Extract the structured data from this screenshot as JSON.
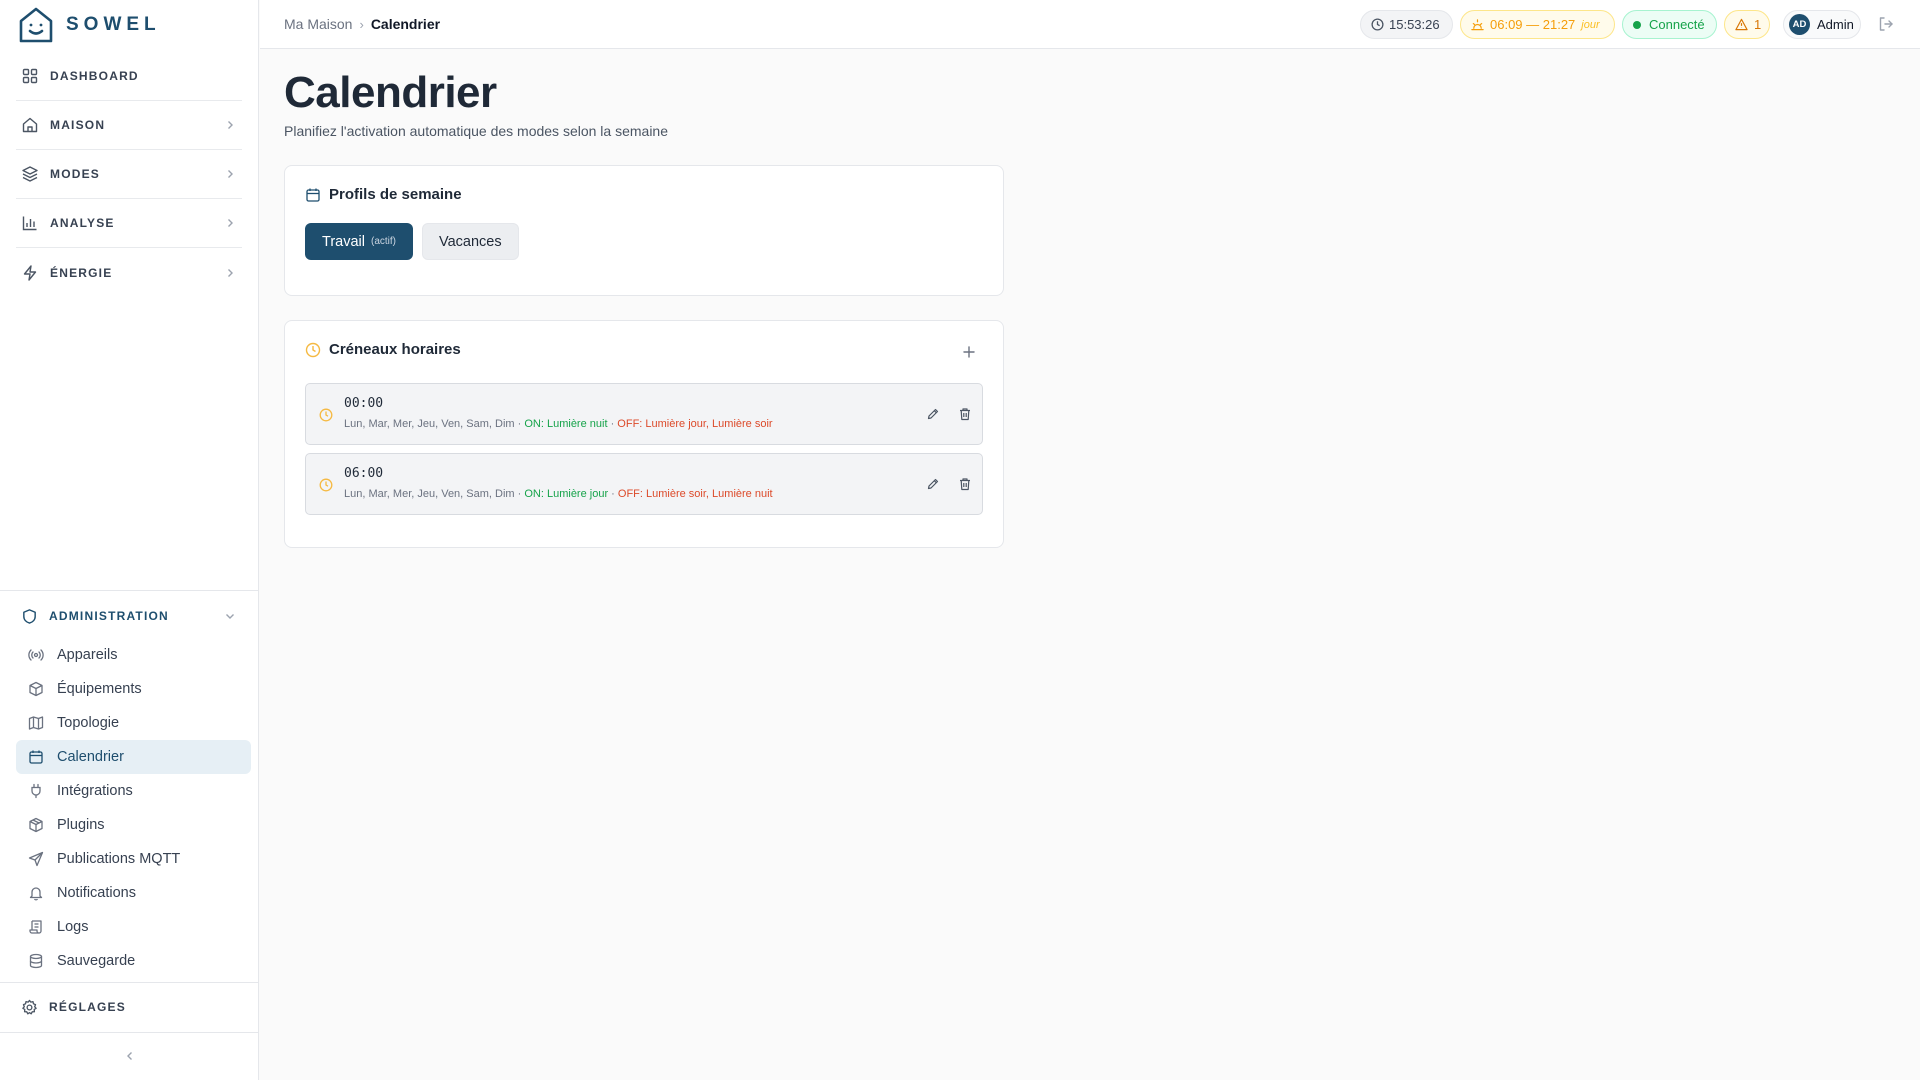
{
  "app": {
    "brand": "SOWEL",
    "brand_color": "#1e4e6e"
  },
  "sidebar": {
    "main_items": [
      {
        "label": "DASHBOARD",
        "icon": "grid-icon"
      },
      {
        "label": "MAISON",
        "icon": "home-icon"
      },
      {
        "label": "MODES",
        "icon": "layers-icon"
      },
      {
        "label": "ANALYSE",
        "icon": "bar-chart-icon"
      },
      {
        "label": "ÉNERGIE",
        "icon": "lightning-icon"
      }
    ],
    "admin": {
      "label": "ADMINISTRATION",
      "items": [
        {
          "label": "Appareils",
          "icon": "radio-icon"
        },
        {
          "label": "Équipements",
          "icon": "box-icon"
        },
        {
          "label": "Topologie",
          "icon": "map-icon"
        },
        {
          "label": "Calendrier",
          "icon": "calendar-icon",
          "active": true
        },
        {
          "label": "Intégrations",
          "icon": "plug-icon"
        },
        {
          "label": "Plugins",
          "icon": "package-icon"
        },
        {
          "label": "Publications MQTT",
          "icon": "send-icon"
        },
        {
          "label": "Notifications",
          "icon": "bell-icon"
        },
        {
          "label": "Logs",
          "icon": "scroll-icon"
        },
        {
          "label": "Sauvegarde",
          "icon": "database-icon"
        }
      ]
    },
    "settings_label": "RÉGLAGES"
  },
  "topbar": {
    "breadcrumb": {
      "parent": "Ma Maison",
      "separator": "›",
      "current": "Calendrier"
    },
    "time": "15:53:26",
    "sun": {
      "range": "06:09 — 21:27",
      "period": "jour"
    },
    "connection": "Connecté",
    "alerts": "1",
    "user": {
      "initials": "AD",
      "name": "Admin"
    }
  },
  "page": {
    "title": "Calendrier",
    "subtitle": "Planifiez l'activation automatique des modes selon la semaine"
  },
  "profiles": {
    "title": "Profils de semaine",
    "items": [
      {
        "label": "Travail",
        "tag": "(actif)",
        "active": true
      },
      {
        "label": "Vacances",
        "active": false
      }
    ]
  },
  "slots": {
    "title": "Créneaux horaires",
    "items": [
      {
        "time": "00:00",
        "days": "Lun, Mar, Mer, Jeu, Ven, Sam, Dim",
        "sep": " · ",
        "on": "ON: Lumière nuit",
        "off": "OFF: Lumière jour, Lumière soir"
      },
      {
        "time": "06:00",
        "days": "Lun, Mar, Mer, Jeu, Ven, Sam, Dim",
        "sep": " · ",
        "on": "ON: Lumière jour",
        "off": "OFF: Lumière soir, Lumière nuit"
      }
    ]
  },
  "colors": {
    "accent": "#1e4e6e",
    "on": "#16a34a",
    "off": "#dc4a2a",
    "warning": "#f59e0b"
  }
}
